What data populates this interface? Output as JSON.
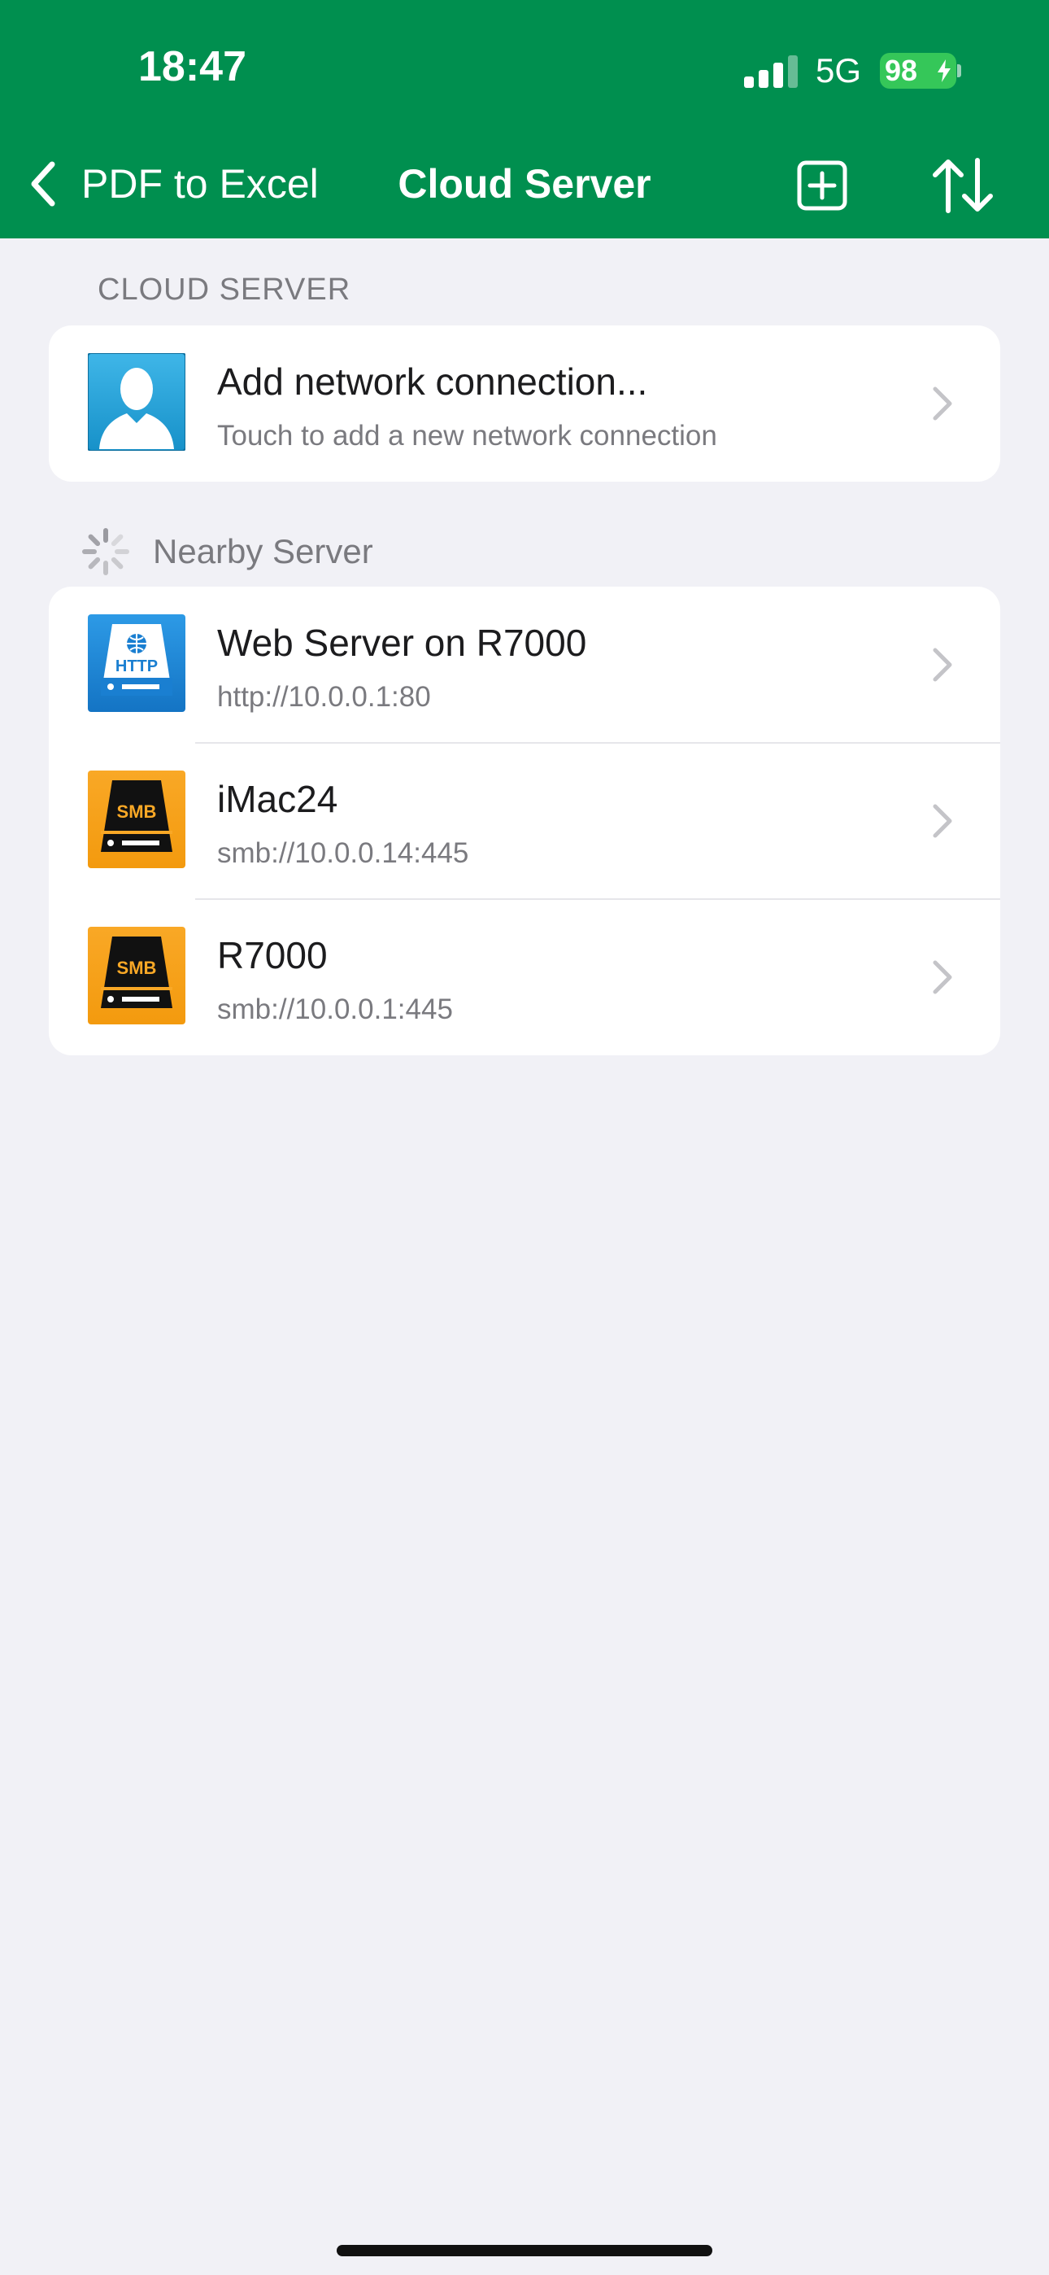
{
  "status_bar": {
    "time": "18:47",
    "network": "5G",
    "battery": "98"
  },
  "nav": {
    "back_label": "PDF to Excel",
    "title": "Cloud Server"
  },
  "cloud_section": {
    "header": "CLOUD SERVER",
    "add_connection": {
      "title": "Add network connection...",
      "subtitle": "Touch to add a new network connection",
      "icon": "user-silhouette-icon"
    }
  },
  "nearby_section": {
    "header": "Nearby Server",
    "servers": [
      {
        "name": "Web Server on R7000",
        "address": "http://10.0.0.1:80",
        "icon": "http-drive-icon",
        "badge": "HTTP"
      },
      {
        "name": "iMac24",
        "address": "smb://10.0.0.14:445",
        "icon": "smb-drive-icon",
        "badge": "SMB"
      },
      {
        "name": "R7000",
        "address": "smb://10.0.0.1:445",
        "icon": "smb-drive-icon",
        "badge": "SMB"
      }
    ]
  },
  "colors": {
    "header_bg": "#008f4f",
    "page_bg": "#f1f1f6",
    "battery": "#35c759",
    "http_icon": "#1a85d6",
    "smb_icon": "#f7a21b"
  }
}
